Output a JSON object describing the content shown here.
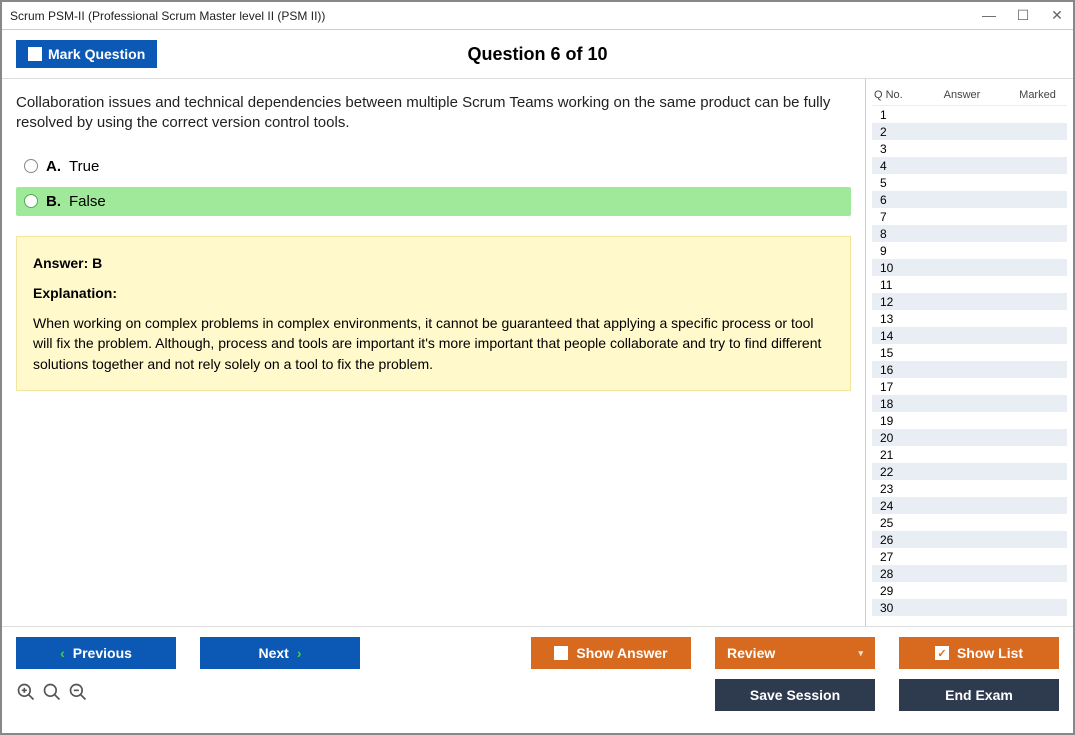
{
  "window": {
    "title": "Scrum PSM-II (Professional Scrum Master level II (PSM II))"
  },
  "toolbar": {
    "mark_label": "Mark Question",
    "counter": "Question 6 of 10"
  },
  "question": {
    "text": "Collaboration issues and technical dependencies between multiple Scrum Teams working on the same product can be fully resolved by using the correct version control tools.",
    "options": [
      {
        "letter": "A.",
        "text": "True",
        "correct": false
      },
      {
        "letter": "B.",
        "text": "False",
        "correct": true
      }
    ],
    "answer_label": "Answer: B",
    "explanation_label": "Explanation:",
    "explanation": "When working on complex problems in complex environments, it cannot be guaranteed that applying a specific process or tool will fix the problem. Although, process and tools are important it's more important that people collaborate and try to find different solutions together and not rely solely on a tool to fix the problem."
  },
  "side": {
    "cols": {
      "qno": "Q No.",
      "answer": "Answer",
      "marked": "Marked"
    },
    "rows": [
      1,
      2,
      3,
      4,
      5,
      6,
      7,
      8,
      9,
      10,
      11,
      12,
      13,
      14,
      15,
      16,
      17,
      18,
      19,
      20,
      21,
      22,
      23,
      24,
      25,
      26,
      27,
      28,
      29,
      30
    ]
  },
  "footer": {
    "previous": "Previous",
    "next": "Next",
    "show_answer": "Show Answer",
    "review": "Review",
    "show_list": "Show List",
    "save_session": "Save Session",
    "end_exam": "End Exam"
  }
}
